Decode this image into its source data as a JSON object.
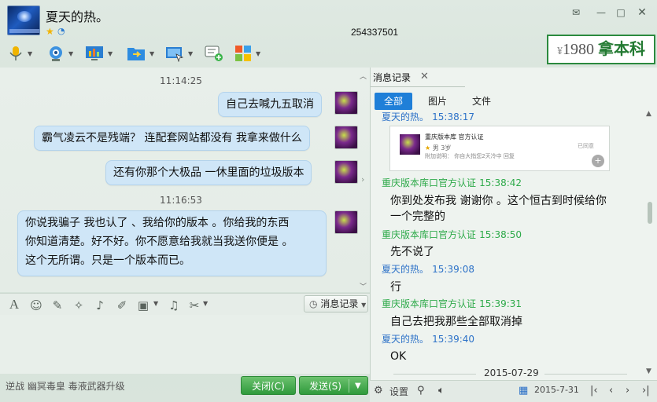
{
  "window": {
    "contact_name": "夏天的热。",
    "qq_number": "254337501",
    "controls": [
      "mail-icon",
      "minimize-icon",
      "maximize-icon",
      "close-icon"
    ]
  },
  "ad": {
    "prefix": "¥",
    "number": "1980",
    "text": "拿本科"
  },
  "toolbar": {
    "items": [
      "voice-icon",
      "video-icon",
      "share-screen-icon",
      "file-transfer-icon",
      "remote-assist-icon",
      "message-plus-icon",
      "apps-icon"
    ]
  },
  "chat": {
    "time1": "11:14:25",
    "msg1": "自己去喊九五取消",
    "msg2": "霸气凌云不是残端？ 连配套网站都没有 我拿来做什么",
    "msg3": "还有你那个大极品 一休里面的垃圾版本",
    "time2": "11:16:53",
    "msg4_lines": [
      "你说我骗子 我也认了 、我给你的版本 。你给我的东西",
      "你知道清楚。好不好。你不愿意给我就当我送你便是 。",
      "这个无所谓。只是一个版本而已。"
    ]
  },
  "input_toolbar": {
    "history_label": "消息记录"
  },
  "bottom": {
    "signature": "逆战 幽冥毒皇 毒液武器升级",
    "close_label": "关闭(C)",
    "send_label": "发送(S)"
  },
  "history": {
    "tab_label": "消息记录",
    "filters": [
      "全部",
      "图片",
      "文件"
    ],
    "entries": [
      {
        "sender": "夏天的热。",
        "time": "15:38:17",
        "me": true,
        "text": ""
      },
      {
        "sender": "重庆版本库口官方认证",
        "time": "15:38:42",
        "me": false,
        "text": "你到处发布我 谢谢你 。这个恒古到时候给你一个完整的"
      },
      {
        "sender": "重庆版本库口官方认证",
        "time": "15:38:50",
        "me": false,
        "text": "先不说了"
      },
      {
        "sender": "夏天的热。",
        "time": "15:39:08",
        "me": true,
        "text": "行"
      },
      {
        "sender": "重庆版本库口官方认证",
        "time": "15:39:31",
        "me": false,
        "text": "自己去把我那些全部取消掉"
      },
      {
        "sender": "夏天的热。",
        "time": "15:39:40",
        "me": true,
        "text": "OK"
      }
    ],
    "card": {
      "title": "重庆版本库  官方认证",
      "line2": "男 3岁",
      "line3": "附加说明：  你自大指您2天冷中  回复",
      "status": "已同意"
    },
    "msg2_line1": "你到处发布我 谢谢你 。这个恒古到时候给你",
    "msg2_line2": "一个完整的",
    "date_sep": "2015-07-29",
    "settings_label": "设置",
    "current_date": "2015-7-31"
  }
}
